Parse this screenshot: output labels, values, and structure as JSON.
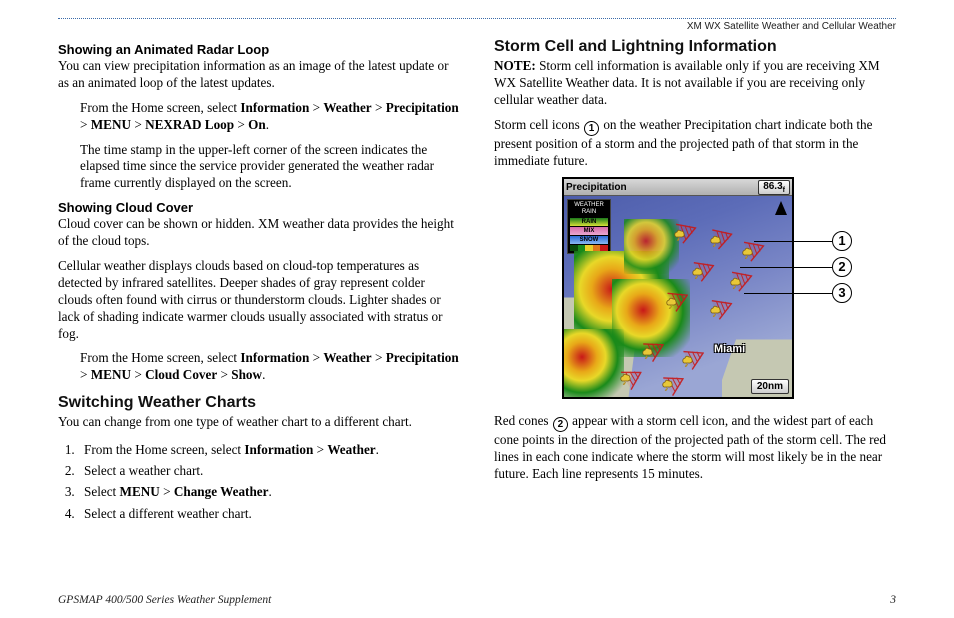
{
  "header": {
    "right": "XM WX Satellite Weather and Cellular Weather"
  },
  "left": {
    "h1": "Showing an Animated Radar Loop",
    "p1": "You can view precipitation information as an image of the latest update or as an animated loop of the latest updates.",
    "path1_pre": "From the Home screen, select ",
    "path1_a": "Information",
    "gt": ">",
    "path1_b": "Weather",
    "path1_c": "Precipitation",
    "path1_d": "MENU",
    "path1_e": "NEXRAD Loop",
    "path1_f": "On",
    "dot": ".",
    "p2": "The time stamp in the upper-left corner of the screen indicates the elapsed time since the service provider generated the weather radar frame currently displayed on the screen.",
    "h2": "Showing Cloud Cover",
    "p3": "Cloud cover can be shown or hidden. XM weather data provides the height of the cloud tops.",
    "p4": "Cellular weather displays clouds based on cloud-top temperatures as detected by infrared satellites. Deeper shades of gray represent colder clouds often found with cirrus or thunderstorm clouds. Lighter shades or lack of shading indicate warmer clouds usually associated with stratus or fog.",
    "path2_pre": "From the Home screen, select ",
    "path2_a": "Information",
    "path2_b": "Weather",
    "path2_c": "Precipitation",
    "path2_d": "MENU",
    "path2_e": "Cloud Cover",
    "path2_f": "Show",
    "h3": "Switching Weather Charts",
    "p5": "You can change from one type of weather chart to a different chart.",
    "steps": {
      "s1_pre": "From the Home screen, select ",
      "s1_a": "Information",
      "s1_b": "Weather",
      "s2": "Select a weather chart.",
      "s3_pre": "Select ",
      "s3_a": "MENU",
      "s3_b": "Change Weather",
      "s4": "Select a different weather chart."
    }
  },
  "right": {
    "h1": "Storm Cell and Lightning Information",
    "note_label": "NOTE:",
    "note": " Storm cell information is available only if you are receiving XM WX Satellite Weather data. It is not available if you are receiving only cellular weather data.",
    "p1a": "Storm cell icons ",
    "p1b": " on the weather Precipitation chart indicate both the present position of a storm and the projected path of that storm in the immediate future.",
    "p2a": "Red cones ",
    "p2b": " appear with a storm cell icon, and the widest part of each cone points in the direction of the projected path of the storm cell. The red lines in each cone indicate where the storm will most likely be in the near future. Each line represents 15 minutes.",
    "callouts": {
      "c1": "1",
      "c2": "2",
      "c3": "3"
    },
    "map": {
      "title": "Precipitation",
      "depth": "86.3",
      "unit": "f",
      "legend_head": "WEATHER RAIN",
      "lg_rain": "RAIN",
      "lg_mix": "MIX",
      "lg_snow": "SNOW",
      "scale": "20nm",
      "city": "Miami"
    }
  },
  "footer": {
    "left": "GPSMAP 400/500 Series Weather Supplement",
    "page": "3"
  },
  "circled": {
    "one": "1",
    "two": "2"
  }
}
